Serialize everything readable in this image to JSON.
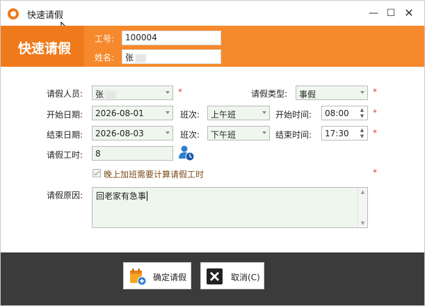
{
  "window": {
    "title": "快速请假"
  },
  "banner": {
    "title": "快速请假",
    "employee_id_label": "工号:",
    "employee_id_value": "100004",
    "name_label": "姓名:",
    "name_value": "张"
  },
  "form": {
    "applicant_label": "请假人员:",
    "applicant_value": "张",
    "leave_type_label": "请假类型:",
    "leave_type_value": "事假",
    "start_date_label": "开始日期:",
    "start_date_value": "2026-08-01",
    "start_shift_label": "班次:",
    "start_shift_value": "上午班",
    "start_time_label": "开始时间:",
    "start_time_value": "08:00",
    "end_date_label": "结束日期:",
    "end_date_value": "2026-08-03",
    "end_shift_label": "班次:",
    "end_shift_value": "下午班",
    "end_time_label": "结束时间:",
    "end_time_value": "17:30",
    "hours_label": "请假工时:",
    "hours_value": "8",
    "overtime_checkbox_label": "晚上加班需要计算请假工时",
    "reason_label": "请假原因:",
    "reason_value": "回老家有急事",
    "required_mark": "*"
  },
  "footer": {
    "confirm_label": "确定请假",
    "cancel_label": "取消(C)"
  },
  "colors": {
    "accent": "#f7892d",
    "footer_bg": "#3b3b3b",
    "required": "#e03a3a",
    "field_bg": "#eef6ee"
  }
}
